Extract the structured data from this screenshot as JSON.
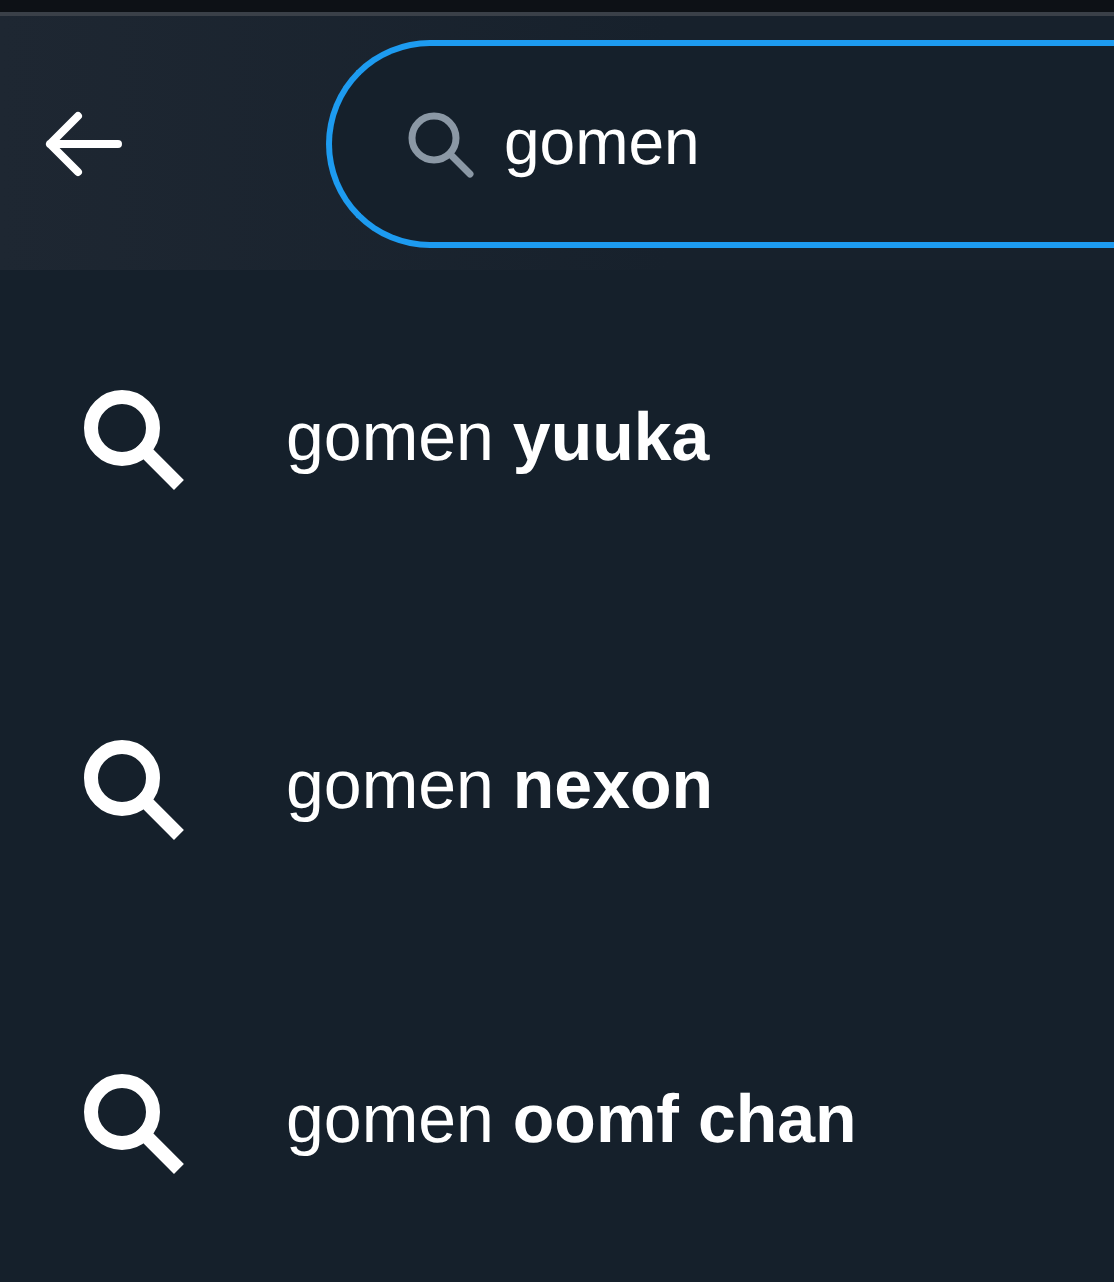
{
  "search": {
    "value": "gomen"
  },
  "suggestions": [
    {
      "text": "gomen **yuuka**"
    },
    {
      "text": "gomen **nexon**"
    },
    {
      "text": "gomen **oomf chan**"
    }
  ]
}
